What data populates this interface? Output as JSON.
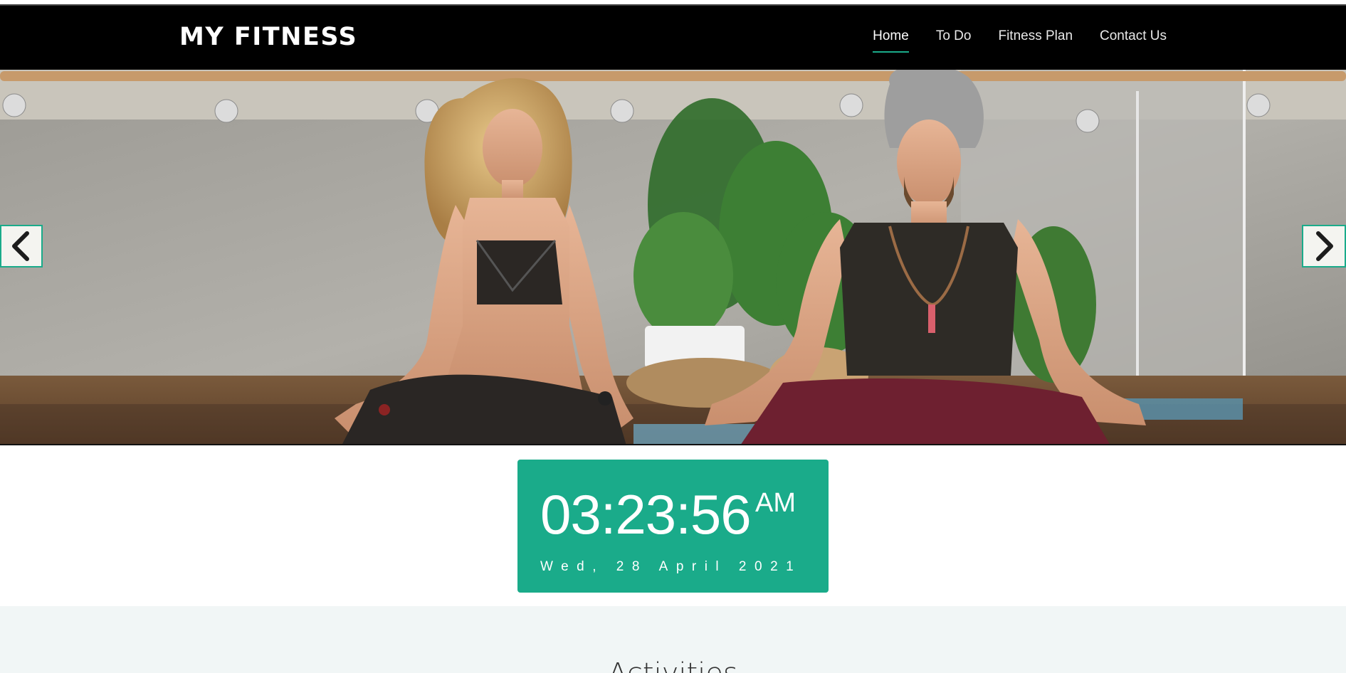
{
  "header": {
    "brand": "MY FITNESS",
    "nav": [
      {
        "label": "Home",
        "active": true
      },
      {
        "label": "To Do",
        "active": false
      },
      {
        "label": "Fitness Plan",
        "active": false
      },
      {
        "label": "Contact Us",
        "active": false
      }
    ]
  },
  "hero": {
    "image_description_icon": "yoga-meditation-photo",
    "prev_icon": "chevron-left-icon",
    "next_icon": "chevron-right-icon"
  },
  "clock": {
    "time": "03:23:56",
    "ampm": "AM",
    "date": "Wed, 28 April 2021"
  },
  "activities": {
    "title": "Activities"
  },
  "colors": {
    "accent": "#1aab8a",
    "navbar": "#000000",
    "section_bg": "#f1f6f6"
  }
}
